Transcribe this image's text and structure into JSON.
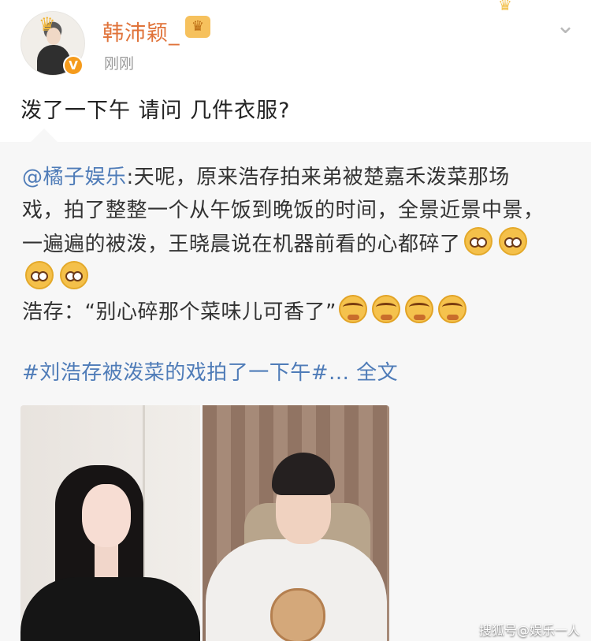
{
  "post": {
    "username": "韩沛颖_",
    "timestamp": "刚刚",
    "text": "泼了一下午 请问 几件衣服?",
    "verified_badge": "V"
  },
  "repost": {
    "mention": "@橘子娱乐",
    "line_1": ":天呢，原来浩存拍来弟被楚嘉禾泼菜那场",
    "line_2": "戏，拍了整整一个从午饭到晚饭的时间，全景近景中景，",
    "line_3": "一遍遍的被泼，王晓晨说在机器前看的心都碎了",
    "line_4": "浩存：“别心碎那个菜味儿可香了”",
    "topic": "#刘浩存被泼菜的戏拍了一下午#... 全文"
  },
  "icons": {
    "avatar": "user-avatar",
    "verified": "verified-badge-icon",
    "vip": "vip-crown-icon",
    "chevron": "chevron-down-icon",
    "emoji_pleading": "pleading-face-emoji",
    "emoji_crying": "crying-face-emoji"
  },
  "watermark": "搜狐号@娱乐一人行",
  "colors": {
    "username": "#e0733a",
    "link": "#4f7cb8",
    "repost_background": "#f7f7f7"
  }
}
